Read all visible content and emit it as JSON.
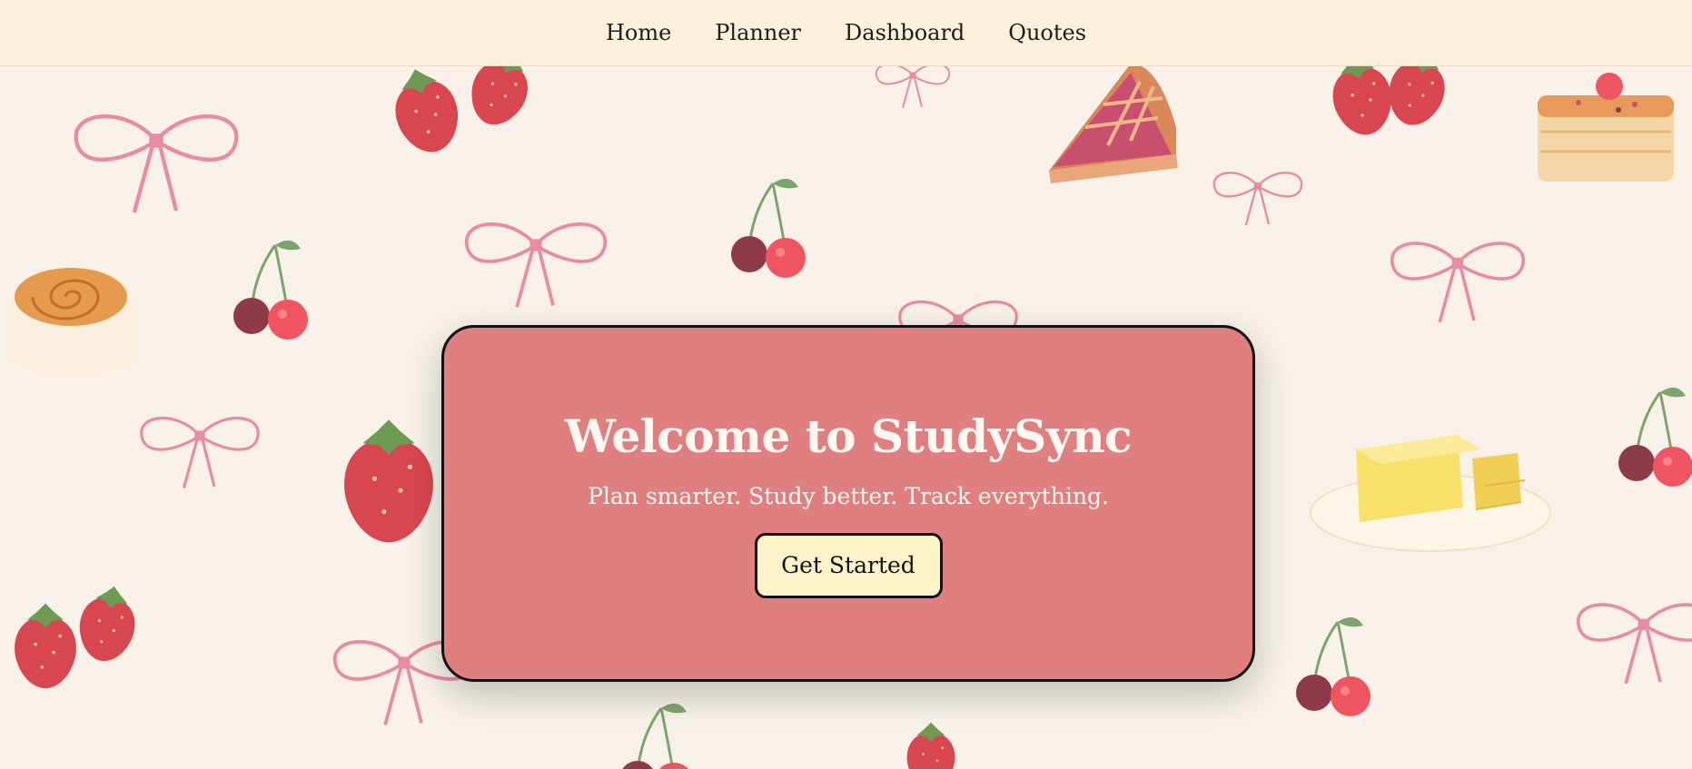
{
  "nav": {
    "items": [
      {
        "label": "Home"
      },
      {
        "label": "Planner"
      },
      {
        "label": "Dashboard"
      },
      {
        "label": "Quotes"
      }
    ]
  },
  "hero": {
    "title": "Welcome to StudySync",
    "subtitle": "Plan smarter. Study better. Track everything.",
    "cta_label": "Get Started"
  },
  "colors": {
    "navbar": "#fbf0d9",
    "background": "#f7f1ea",
    "card": "#e07f80",
    "button": "#fdf3c9",
    "bow": "#e88ba6",
    "strawberry": "#d8474f",
    "cherry": "#ef5561",
    "leaf": "#7ea46d"
  },
  "icons": [
    "bow-icon",
    "strawberry-icon",
    "cherry-icon",
    "pie-slice-icon",
    "cake-icon",
    "cinnamon-roll-icon",
    "butter-icon"
  ]
}
